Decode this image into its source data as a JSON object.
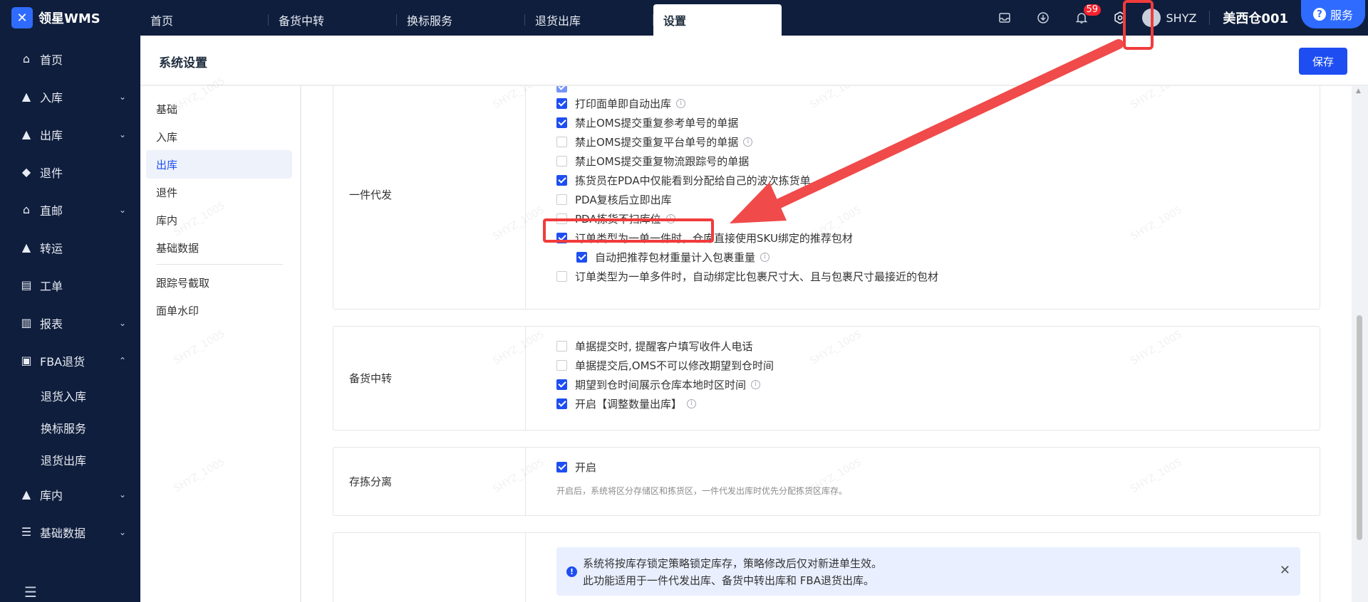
{
  "app": {
    "logo_text": "领星WMS"
  },
  "top_tabs": [
    {
      "label": "首页"
    },
    {
      "label": "备货中转"
    },
    {
      "label": "换标服务"
    },
    {
      "label": "退货出库"
    },
    {
      "label": "设置"
    }
  ],
  "top_right": {
    "notification_count": "59",
    "username": "SHYZ",
    "warehouse": "美西仓001",
    "service_label": "服务"
  },
  "sidebar": {
    "items": [
      {
        "label": "首页"
      },
      {
        "label": "入库"
      },
      {
        "label": "出库"
      },
      {
        "label": "退件"
      },
      {
        "label": "直邮"
      },
      {
        "label": "转运"
      },
      {
        "label": "工单"
      },
      {
        "label": "报表"
      },
      {
        "label": "FBA退货"
      },
      {
        "label": "退货入库"
      },
      {
        "label": "换标服务"
      },
      {
        "label": "退货出库"
      },
      {
        "label": "库内"
      },
      {
        "label": "基础数据"
      }
    ]
  },
  "header": {
    "title": "系统设置",
    "save_label": "保存"
  },
  "settings_menu": {
    "items": [
      {
        "label": "基础"
      },
      {
        "label": "入库"
      },
      {
        "label": "出库"
      },
      {
        "label": "退件"
      },
      {
        "label": "库内"
      },
      {
        "label": "基础数据"
      },
      {
        "label": "跟踪号截取"
      },
      {
        "label": "面单水印"
      }
    ]
  },
  "sections": {
    "single": {
      "label": "一件代发",
      "options": [
        {
          "label": "打印面单即自动出库",
          "checked": true
        },
        {
          "label": "禁止OMS提交重复参考单号的单据",
          "checked": true
        },
        {
          "label": "禁止OMS提交重复平台单号的单据",
          "checked": false
        },
        {
          "label": "禁止OMS提交重复物流跟踪号的单据",
          "checked": false
        },
        {
          "label": "拣货员在PDA中仅能看到分配给自己的波次拣货单",
          "checked": true
        },
        {
          "label": "PDA复核后立即出库",
          "checked": false
        },
        {
          "label": "PDA拣货不扫库位",
          "checked": false
        },
        {
          "label": "订单类型为一单一件时，仓库直接使用SKU绑定的推荐包材",
          "checked": true
        },
        {
          "label": "自动把推荐包材重量计入包裹重量",
          "checked": true
        },
        {
          "label": "订单类型为一单多件时，自动绑定比包裹尺寸大、且与包裹尺寸最接近的包材",
          "checked": false
        }
      ]
    },
    "transfer": {
      "label": "备货中转",
      "options": [
        {
          "label": "单据提交时, 提醒客户填写收件人电话",
          "checked": false
        },
        {
          "label": "单据提交后,OMS不可以修改期望到仓时间",
          "checked": false
        },
        {
          "label": "期望到仓时间展示仓库本地时区时间",
          "checked": true
        },
        {
          "label": "开启【调整数量出库】",
          "checked": true
        }
      ]
    },
    "separation": {
      "label": "存拣分离",
      "option": {
        "label": "开启",
        "checked": true
      },
      "hint": "开启后，系统将区分存储区和拣货区，一件代发出库时优先分配拣货区库存。"
    },
    "lock": {
      "alert_line1": "系统将按库存锁定策略锁定库存，策略修改后仅对新进单生效。",
      "alert_line2": "此功能适用于一件代发出库、备货中转出库和 FBA退货出库。"
    }
  },
  "watermark_text": "SHYZ_1005",
  "colors": {
    "nav_bg": "#0f1e3c",
    "primary": "#1e4ef2",
    "highlight": "#f03c3c"
  }
}
